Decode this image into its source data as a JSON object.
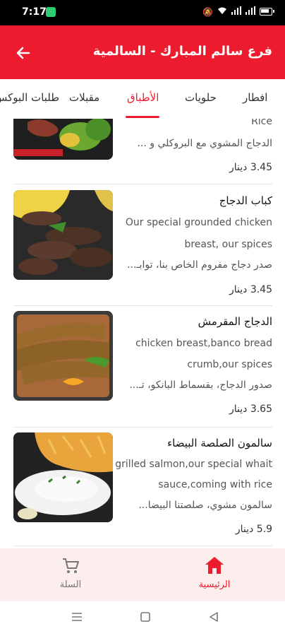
{
  "status_bar": {
    "time": "7:17"
  },
  "app_bar": {
    "title": "فرع سالم المبارك - السالمية",
    "back_icon": "arrow-left-icon"
  },
  "tabs": [
    {
      "label": "افطار",
      "active": false
    },
    {
      "label": "حلويات",
      "active": false
    },
    {
      "label": "الأطباق",
      "active": true
    },
    {
      "label": "مقبلات",
      "active": false
    },
    {
      "label": "طلبات البوكس",
      "active": false
    }
  ],
  "items": [
    {
      "name": "",
      "desc_lines": [
        "Rice",
        "الدجاج المشوي مع البروكلي و ..."
      ],
      "price": "3.45 دينار"
    },
    {
      "name": "كباب الدجاج",
      "desc_lines": [
        "Our special grounded chicken",
        "breast, our spices",
        "صدر دجاج مفروم الخاص بنا، توابـ..."
      ],
      "price": "3.45 دينار"
    },
    {
      "name": "الدجاج المقرمش",
      "desc_lines": [
        "chicken breast,banco bread",
        "crumb,our spices",
        "صدور الدجاج، بقسماط البانكو، تـ..."
      ],
      "price": "3.65 دينار"
    },
    {
      "name": "سالمون الصلصة البيضاء",
      "desc_lines": [
        "grilled salmon,our special whait",
        "sauce,coming with rice",
        "سالمون مشوي، صلصتنا البيضا..."
      ],
      "price": "5.9 دينار"
    }
  ],
  "bottom_nav": {
    "home_label": "الرئيسية",
    "cart_label": "السلة"
  },
  "colors": {
    "brand": "#ec1b2e",
    "nav_bg": "#fbeeed"
  }
}
